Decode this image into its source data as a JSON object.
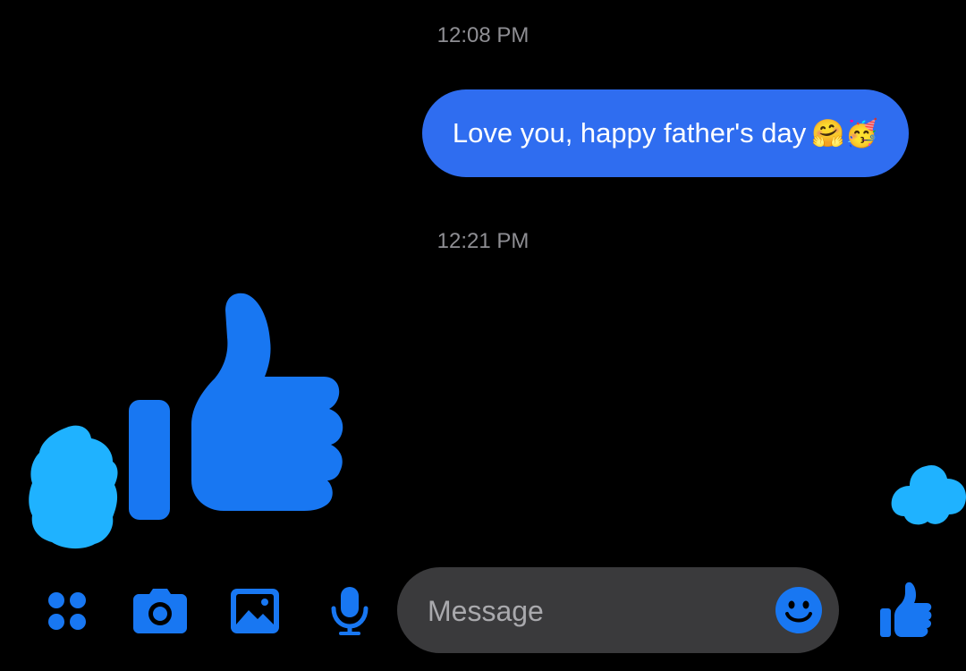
{
  "conversation": {
    "timestamps": [
      "12:08 PM",
      "12:21 PM"
    ],
    "outgoing_message": {
      "text": "Love you, happy father's day",
      "emojis": "🤗🥳"
    },
    "received_reaction": "thumbs-up-icon"
  },
  "composer": {
    "tools": [
      "apps-grid-icon",
      "camera-icon",
      "gallery-icon",
      "microphone-icon"
    ],
    "message_placeholder": "Message",
    "emoji_button": "smiley-icon",
    "send_like_button": "thumbs-up-icon"
  },
  "colors": {
    "background": "#000000",
    "accent": "#1877f2",
    "outgoing_bubble": "#2f6df0",
    "input_background": "#3a3a3c",
    "timestamp_text": "#8e8e93"
  }
}
